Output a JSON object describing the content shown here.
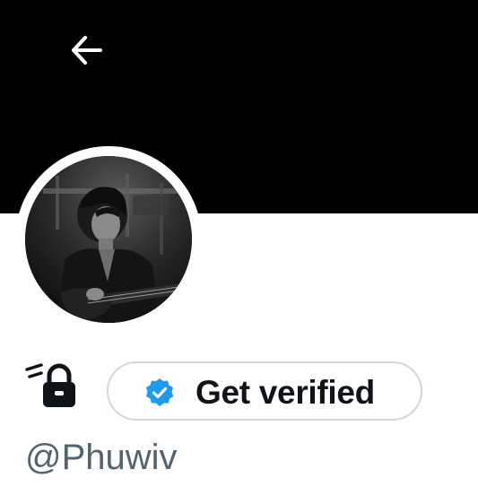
{
  "profile": {
    "handle": "@Phuwiv",
    "is_protected": true,
    "avatar_description": "black and white photo"
  },
  "header": {
    "back_icon": "arrow-left-icon",
    "banner_color": "#000000"
  },
  "actions": {
    "get_verified_label": "Get verified",
    "verified_badge_icon": "verified-badge-icon",
    "verified_badge_color": "#1d9bf0"
  },
  "colors": {
    "primary_text": "#0f1419",
    "secondary_text": "#536471",
    "border": "#cfd9de"
  }
}
